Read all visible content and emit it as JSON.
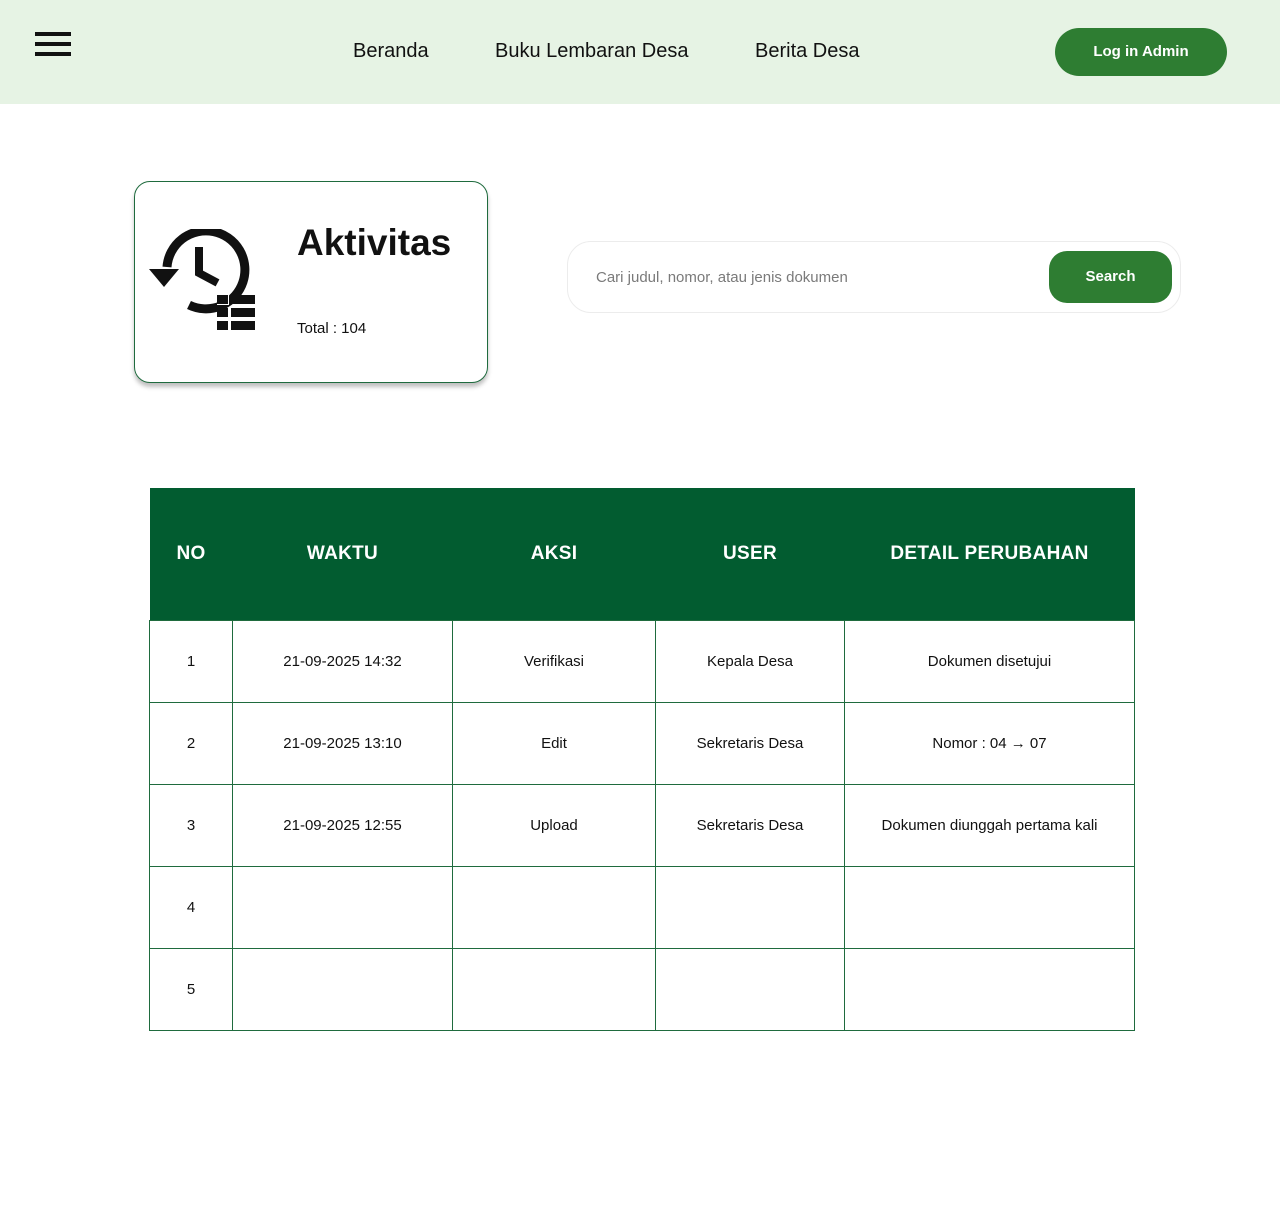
{
  "header": {
    "menu_icon": "hamburger-menu-icon",
    "nav": [
      "Beranda",
      "Buku Lembaran Desa",
      "Berita Desa"
    ],
    "login_label": "Log in Admin"
  },
  "card": {
    "icon": "history-list-icon",
    "title": "Aktivitas",
    "total": "Total : 104"
  },
  "search": {
    "placeholder": "Cari judul, nomor, atau jenis dokumen",
    "button_label": "Search"
  },
  "table": {
    "headers": [
      "NO",
      "WAKTU",
      "AKSI",
      "USER",
      "DETAIL PERUBAHAN"
    ],
    "rows": [
      [
        "1",
        "21-09-2025 14:32",
        "Verifikasi",
        "Kepala Desa",
        "Dokumen disetujui"
      ],
      [
        "2",
        "21-09-2025 13:10",
        "Edit",
        "Sekretaris Desa",
        "Nomor : 04 → 07"
      ],
      [
        "3",
        "21-09-2025 12:55",
        "Upload",
        "Sekretaris Desa",
        "Dokumen diunggah pertama kali"
      ],
      [
        "4",
        "",
        "",
        "",
        ""
      ],
      [
        "5",
        "",
        "",
        "",
        ""
      ]
    ]
  },
  "colors": {
    "header_bg": "#e6f3e4",
    "accent": "#2e7d32",
    "table_header": "#025c30",
    "border": "#1f6b3e"
  }
}
